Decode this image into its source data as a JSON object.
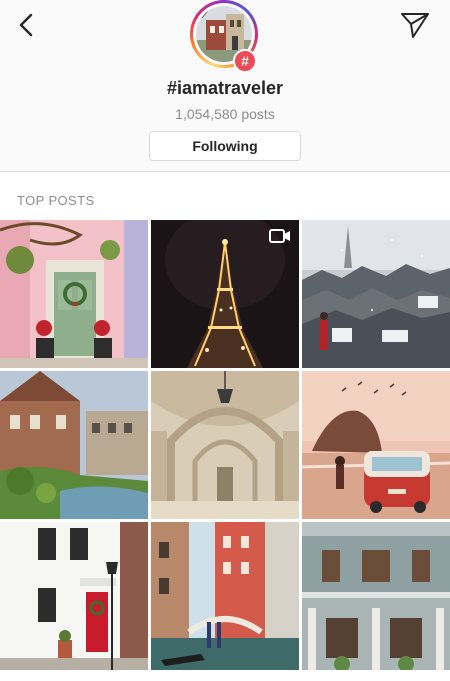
{
  "header": {
    "back_icon": "chevron-left-icon",
    "send_icon": "paper-plane-icon",
    "hashtag_badge": "#",
    "tag": "#iamatraveler",
    "posts_count": "1,054,580 posts",
    "follow_label": "Following"
  },
  "section": {
    "label": "TOP POSTS"
  },
  "grid": {
    "posts": [
      {
        "scene": "green-door-wreath",
        "video": false
      },
      {
        "scene": "eiffel-tower-night",
        "video": true
      },
      {
        "scene": "snowy-rooftops",
        "video": false
      },
      {
        "scene": "river-old-town",
        "video": false
      },
      {
        "scene": "arched-colonnade",
        "video": false
      },
      {
        "scene": "beach-van-sunset",
        "video": false
      },
      {
        "scene": "white-house-red-door",
        "video": false
      },
      {
        "scene": "venice-canal",
        "video": false
      },
      {
        "scene": "shophouse-facade",
        "video": false
      }
    ]
  },
  "colors": {
    "badge": "#ed4956",
    "muted": "#8e8e8e",
    "border": "#dbdbdb"
  }
}
